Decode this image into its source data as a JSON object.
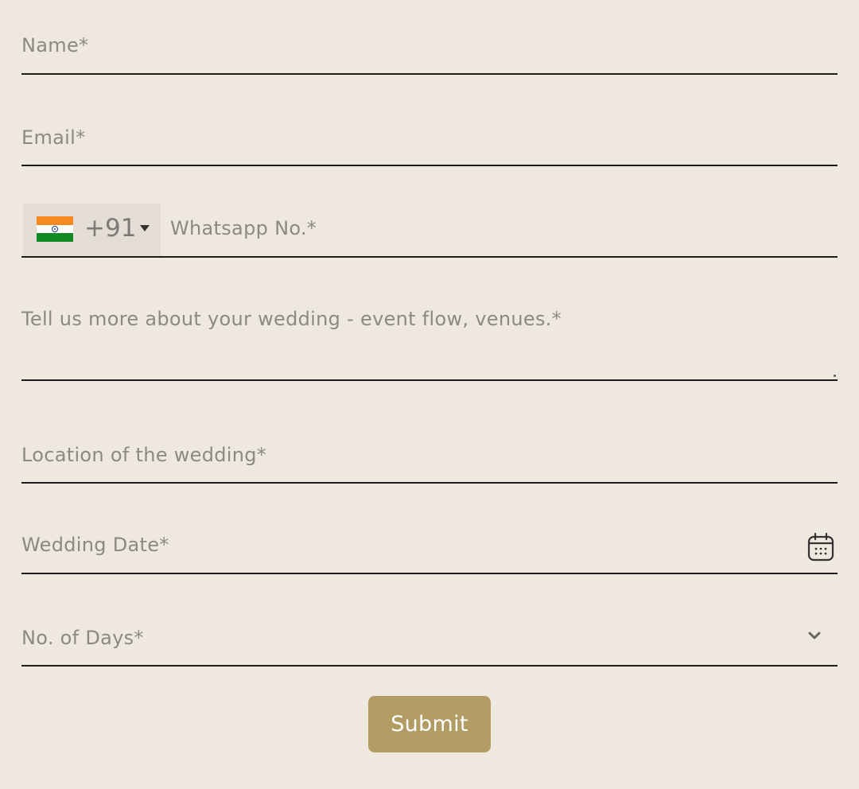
{
  "form": {
    "name": {
      "placeholder": "Name*",
      "value": ""
    },
    "email": {
      "placeholder": "Email*",
      "value": ""
    },
    "phone": {
      "country_flag": "india-flag-icon",
      "dial_code": "+91",
      "placeholder": "Whatsapp No.*",
      "value": ""
    },
    "about": {
      "placeholder": "Tell us more about your wedding - event flow, venues.*",
      "value": ""
    },
    "location": {
      "placeholder": "Location of the wedding*",
      "value": ""
    },
    "date": {
      "placeholder": "Wedding Date*",
      "value": "",
      "icon": "calendar-icon"
    },
    "days": {
      "placeholder": "No. of Days*",
      "selected": "",
      "icon": "chevron-down-icon"
    },
    "submit_label": "Submit"
  },
  "colors": {
    "background": "#efe8df",
    "field_line": "#1c1c1c",
    "placeholder": "#8c8884",
    "country_select_bg": "#e4ddd6",
    "submit_bg": "#b39c63",
    "submit_text": "#ffffff"
  }
}
